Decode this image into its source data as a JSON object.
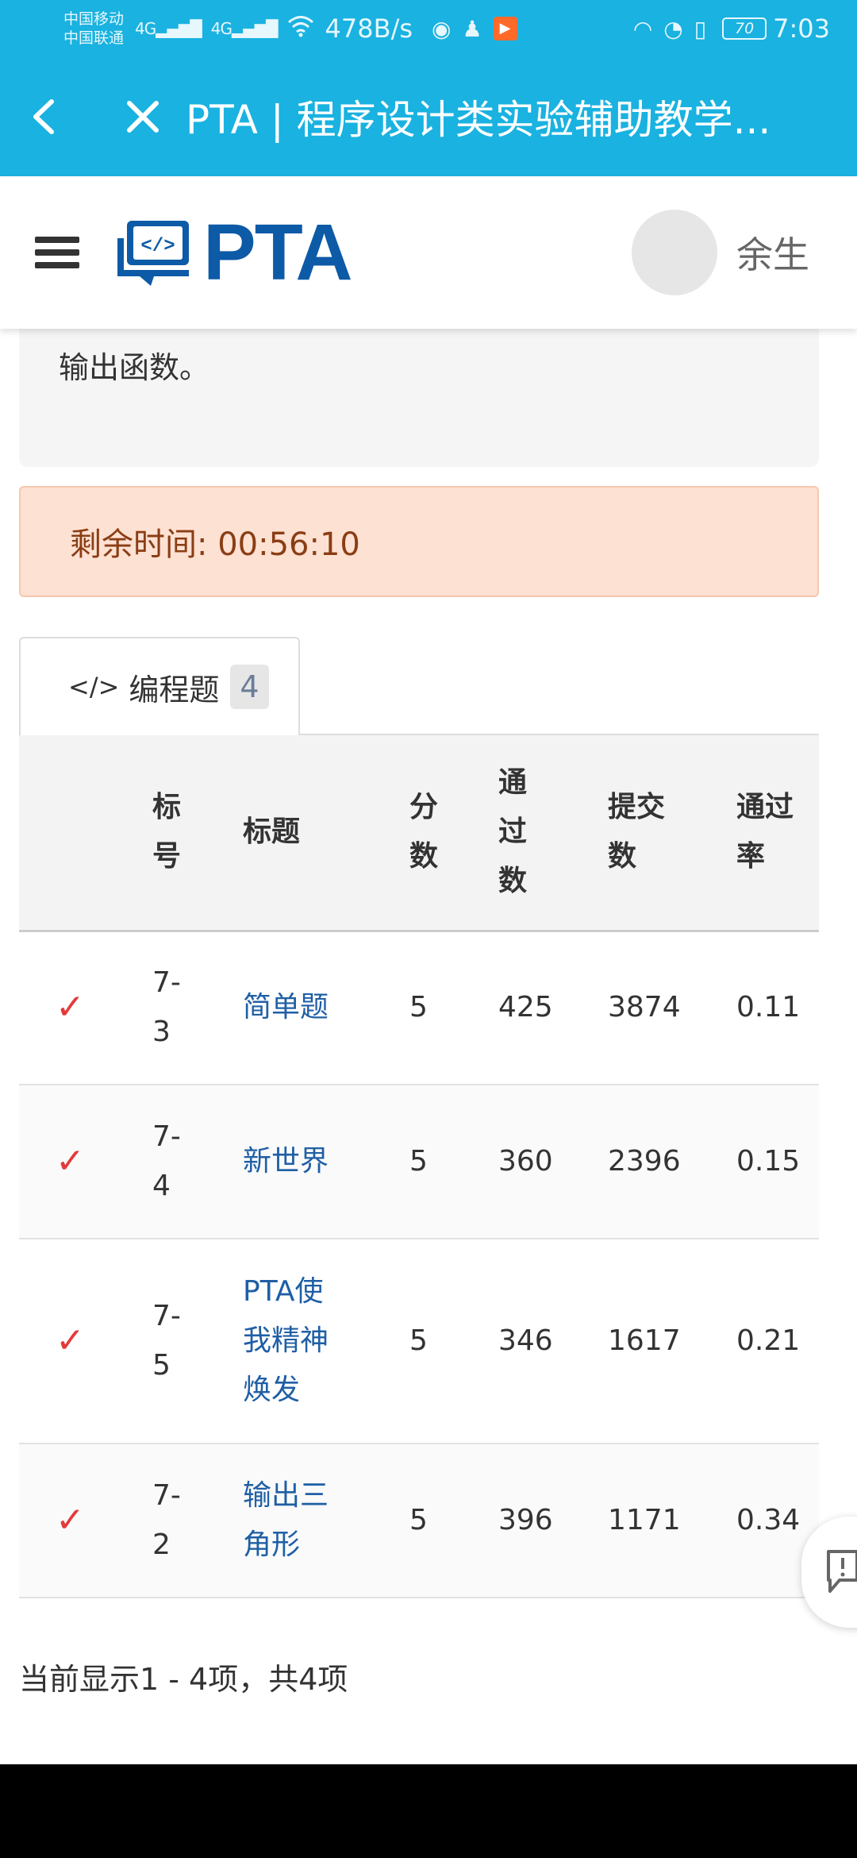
{
  "status_bar": {
    "carrier_1": "中国移动",
    "carrier_2": "中国联通",
    "signal_1": "4G",
    "signal_2": "4G",
    "net_speed": "478B/s",
    "battery": "70",
    "time": "7:03"
  },
  "app_bar": {
    "title": "PTA | 程序设计类实验辅助教学..."
  },
  "header": {
    "logo_text": "PTA",
    "user_name": "余生"
  },
  "description": {
    "text": "输出函数。"
  },
  "timer": {
    "text": "剩余时间: 00:56:10"
  },
  "tab": {
    "label": "编程题",
    "count": "4"
  },
  "table": {
    "headers": {
      "id": "标号",
      "title": "标题",
      "score": "分数",
      "passed": "通过数",
      "submitted": "提交数",
      "rate": "通过率"
    },
    "rows": [
      {
        "id": "7-3",
        "title": "简单题",
        "score": "5",
        "passed": "425",
        "submitted": "3874",
        "rate": "0.11"
      },
      {
        "id": "7-4",
        "title": "新世界",
        "score": "5",
        "passed": "360",
        "submitted": "2396",
        "rate": "0.15"
      },
      {
        "id": "7-5",
        "title": "PTA使我精神焕发",
        "score": "5",
        "passed": "346",
        "submitted": "1617",
        "rate": "0.21"
      },
      {
        "id": "7-2",
        "title": "输出三角形",
        "score": "5",
        "passed": "396",
        "submitted": "1171",
        "rate": "0.34"
      }
    ]
  },
  "summary": "当前显示1 - 4项，共4项",
  "colors": {
    "app_bar": "#1ab2e0",
    "logo": "#0d5aa7",
    "link": "#1f5fa5",
    "check": "#e43a3a",
    "timer_bg": "#fde1d3"
  }
}
